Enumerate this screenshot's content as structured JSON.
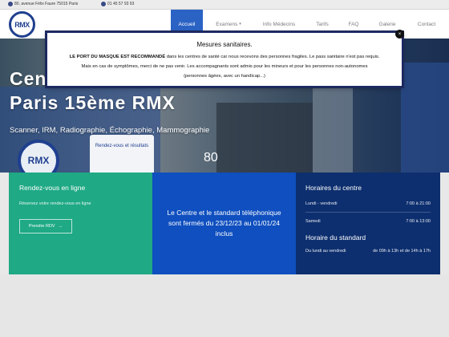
{
  "topbar": {
    "address": "80, avenue Félix Faure 75015 Paris",
    "phone": "01 45 57 93 93"
  },
  "logo": {
    "text": "RMX"
  },
  "nav": {
    "items": [
      {
        "label": "Accueil",
        "active": true
      },
      {
        "label": "Examens",
        "has_dropdown": true
      },
      {
        "label": "Info Médecins"
      },
      {
        "label": "Tarifs"
      },
      {
        "label": "FAQ"
      },
      {
        "label": "Galerie"
      },
      {
        "label": "Contact"
      }
    ]
  },
  "hero": {
    "title_line1": "Cen",
    "title_line2": "Paris 15ème RMX",
    "subtitle": "Scanner, IRM, Radiographie, Échographie, Mammographie",
    "number": "80",
    "sign_text": "Rendez-vous et résultats",
    "logo_text": "RMX"
  },
  "modal": {
    "title": "Mesures sanitaires.",
    "line1_bold": "LE PORT DU MASQUE EST RECOMMANDÉ",
    "line1_rest": " dans les centres de santé car nous recevons des personnes fragiles. Le pass sanitaire n'est pas requis.",
    "line2": "Mais en cas de symptômes, merci de ne pas venir. Les accompagnants sont admis pour les mineurs et pour les personnes non-autonomes",
    "line3": "(personnes âgées, avec un handicap...)",
    "close_label": "×"
  },
  "rdv": {
    "title": "Rendez-vous en ligne",
    "text": "Réservez votre rendez-vous en ligne",
    "button_label": "Prendre RDV",
    "button_arrow": "→"
  },
  "notice": {
    "text": "Le Centre et le standard téléphonique sont fermés du 23/12/23 au 01/01/24 inclus"
  },
  "horaires": {
    "title": "Horaires du centre",
    "rows": [
      {
        "day": "Lundi - vendredi",
        "hours": "7:00 à 21:00"
      },
      {
        "day": "Samedi",
        "hours": "7:00 à 13:00"
      }
    ],
    "standard_title": "Horaire du standard",
    "standard_row": {
      "day": "Du lundi au vendredi",
      "hours": "de 09h à 13h et de 14h à 17h"
    }
  },
  "colors": {
    "accent": "#2b63c5",
    "green": "#1fa985",
    "blue": "#0f4fbf",
    "navy": "#0d2f6f"
  }
}
